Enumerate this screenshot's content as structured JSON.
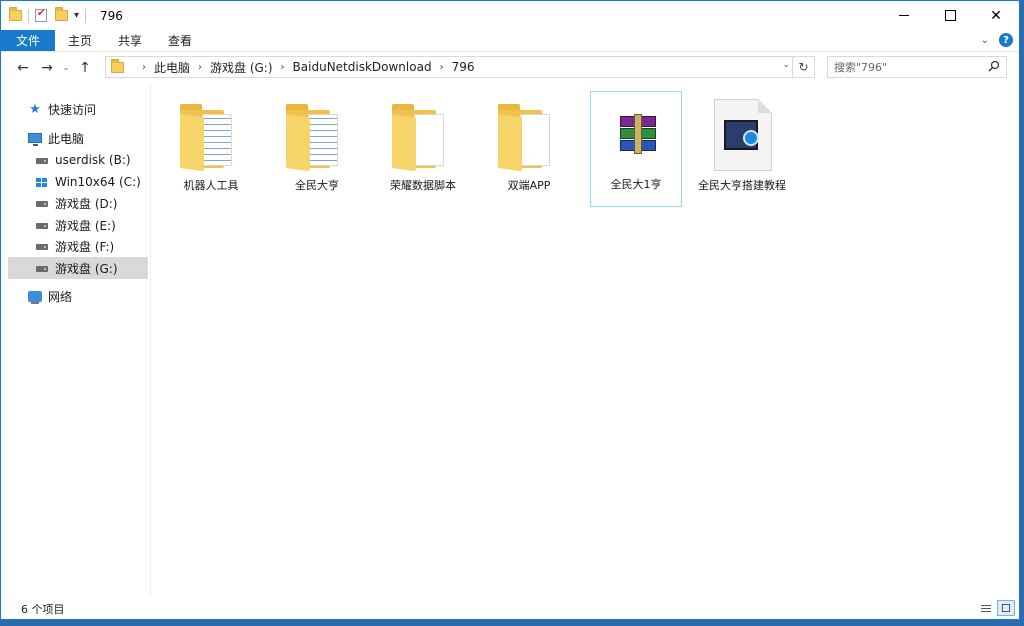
{
  "window": {
    "title": "796"
  },
  "ribbon": {
    "tabs": [
      {
        "label": "文件"
      },
      {
        "label": "主页"
      },
      {
        "label": "共享"
      },
      {
        "label": "查看"
      }
    ]
  },
  "address": {
    "crumbs": [
      "此电脑",
      "游戏盘 (G:)",
      "BaiduNetdiskDownload",
      "796"
    ]
  },
  "search": {
    "placeholder": "搜索\"796\""
  },
  "sidebar": {
    "quick_access": "快速访问",
    "this_pc": "此电脑",
    "drives": [
      "userdisk (B:)",
      "Win10x64 (C:)",
      "游戏盘 (D:)",
      "游戏盘 (E:)",
      "游戏盘 (F:)",
      "游戏盘 (G:)"
    ],
    "network": "网络"
  },
  "files": [
    {
      "name": "机器人工具",
      "kind": "folder"
    },
    {
      "name": "全民大亨",
      "kind": "folder"
    },
    {
      "name": "荣耀数据脚本",
      "kind": "folder"
    },
    {
      "name": "双端APP",
      "kind": "folder"
    },
    {
      "name": "全民大1亨",
      "kind": "rar-archive"
    },
    {
      "name": "全民大亨搭建教程",
      "kind": "video"
    }
  ],
  "status": {
    "count": "6 个项目"
  }
}
